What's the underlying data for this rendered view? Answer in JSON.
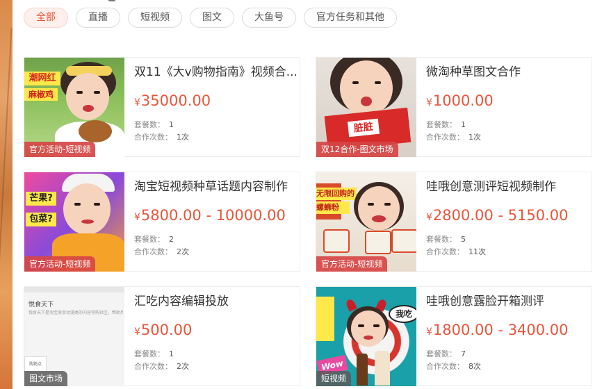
{
  "filters": [
    {
      "label": "全部",
      "active": true
    },
    {
      "label": "直播",
      "active": false
    },
    {
      "label": "短视频",
      "active": false
    },
    {
      "label": "图文",
      "active": false
    },
    {
      "label": "大鱼号",
      "active": false
    },
    {
      "label": "官方任务和其他",
      "active": false
    }
  ],
  "labels": {
    "currency": "¥",
    "sets": "套餐数：",
    "times": "合作次数："
  },
  "cards": [
    {
      "title": "双11《大v购物指南》视频合...",
      "price": "35000.00",
      "sets": "1",
      "times": "1次",
      "tag": "官方活动-短视频",
      "thumb_text": [
        "潮网红",
        "麻椒鸡"
      ]
    },
    {
      "title": "微淘种草图文合作",
      "price": "1000.00",
      "sets": "1",
      "times": "1次",
      "tag": "双12合作-图文市场",
      "thumb_text": [
        "脏脏"
      ]
    },
    {
      "title": "淘宝短视频种草话题内容制作",
      "price": "5800.00 - 10000.00",
      "sets": "2",
      "times": "2次",
      "tag": "官方活动-短视频",
      "thumb_text": [
        "芒果?",
        "包菜?"
      ]
    },
    {
      "title": "哇哦创意测评短视频制作",
      "price": "2800.00 - 5150.00",
      "sets": "5",
      "times": "11次",
      "tag": "官方活动-短视频",
      "thumb_text": [
        "无限回购的",
        "螺蛳粉"
      ]
    },
    {
      "title": "汇吃内容编辑投放",
      "price": "500.00",
      "sets": "1",
      "times": "2次",
      "tag": "图文市场",
      "thumb_text": [
        "悦食天下",
        "悦食天下是淘宝美食动漫类的内容导购社区，帮助用",
        "购物点"
      ]
    },
    {
      "title": "哇哦创意露脸开箱测评",
      "price": "1800.00 - 3400.00",
      "sets": "7",
      "times": "8次",
      "tag": "短视频",
      "thumb_text": [
        "我吃",
        "Wow"
      ]
    }
  ]
}
